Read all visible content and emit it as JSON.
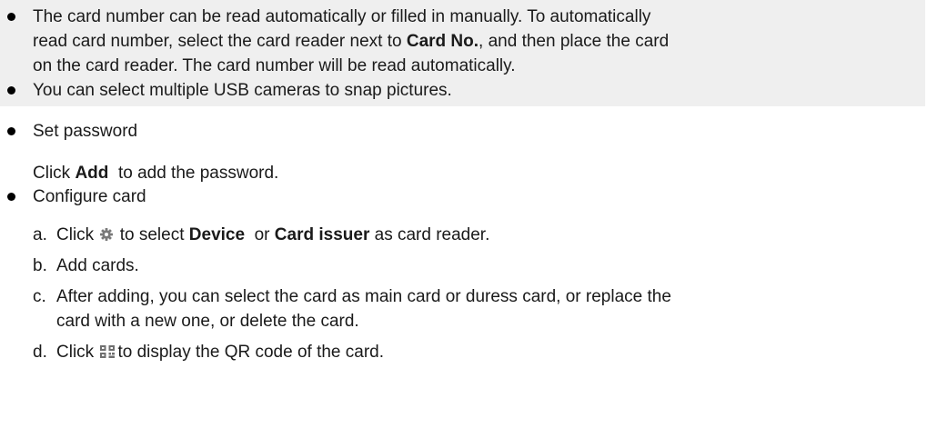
{
  "note": {
    "item1_line1": "The card number can be read automatically or filled in manually. To automatically",
    "item1_line2_pre": "read card number, select the card reader next to ",
    "item1_line2_bold": "Card No.",
    "item1_line2_post": ", and then place the card",
    "item1_line3": "on the card reader. The card number will be read automatically.",
    "item2": "You can select multiple USB cameras to snap pictures."
  },
  "password": {
    "heading": "Set password",
    "text_pre": "Click ",
    "text_bold": "Add",
    "text_post": "  to add the password."
  },
  "card": {
    "heading": "Configure card",
    "step_a_letter": "a.",
    "step_a_pre": "Click",
    "step_a_mid": " to select ",
    "step_a_bold1": "Device",
    "step_a_or": "  or ",
    "step_a_bold2": "Card issuer",
    "step_a_post": " as card reader.",
    "step_b_letter": "b.",
    "step_b": "Add cards.",
    "step_c_letter": "c.",
    "step_c_line1": "After adding, you can select the card as main card or duress card, or replace the",
    "step_c_line2": "card with a new one, or delete the card.",
    "step_d_letter": "d.",
    "step_d_pre": "Click",
    "step_d_post": "to display the QR code of the card."
  },
  "icons": {
    "gear": "gear-icon",
    "qr": "qr-code-icon"
  }
}
